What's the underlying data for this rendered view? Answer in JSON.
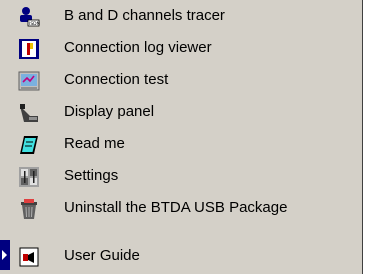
{
  "menu": {
    "items": [
      {
        "label": "B and D channels tracer",
        "icon": "tracer-icon"
      },
      {
        "label": "Connection log viewer",
        "icon": "log-viewer-icon"
      },
      {
        "label": "Connection test",
        "icon": "connection-test-icon"
      },
      {
        "label": "Display panel",
        "icon": "display-panel-icon"
      },
      {
        "label": "Read me",
        "icon": "read-me-icon"
      },
      {
        "label": "Settings",
        "icon": "settings-icon"
      },
      {
        "label": "Uninstall the BTDA USB Package",
        "icon": "uninstall-icon"
      },
      {
        "label": "User Guide",
        "icon": "user-guide-icon"
      }
    ]
  },
  "colors": {
    "menu_background": "#d4d0c8",
    "selection": "#000080"
  }
}
